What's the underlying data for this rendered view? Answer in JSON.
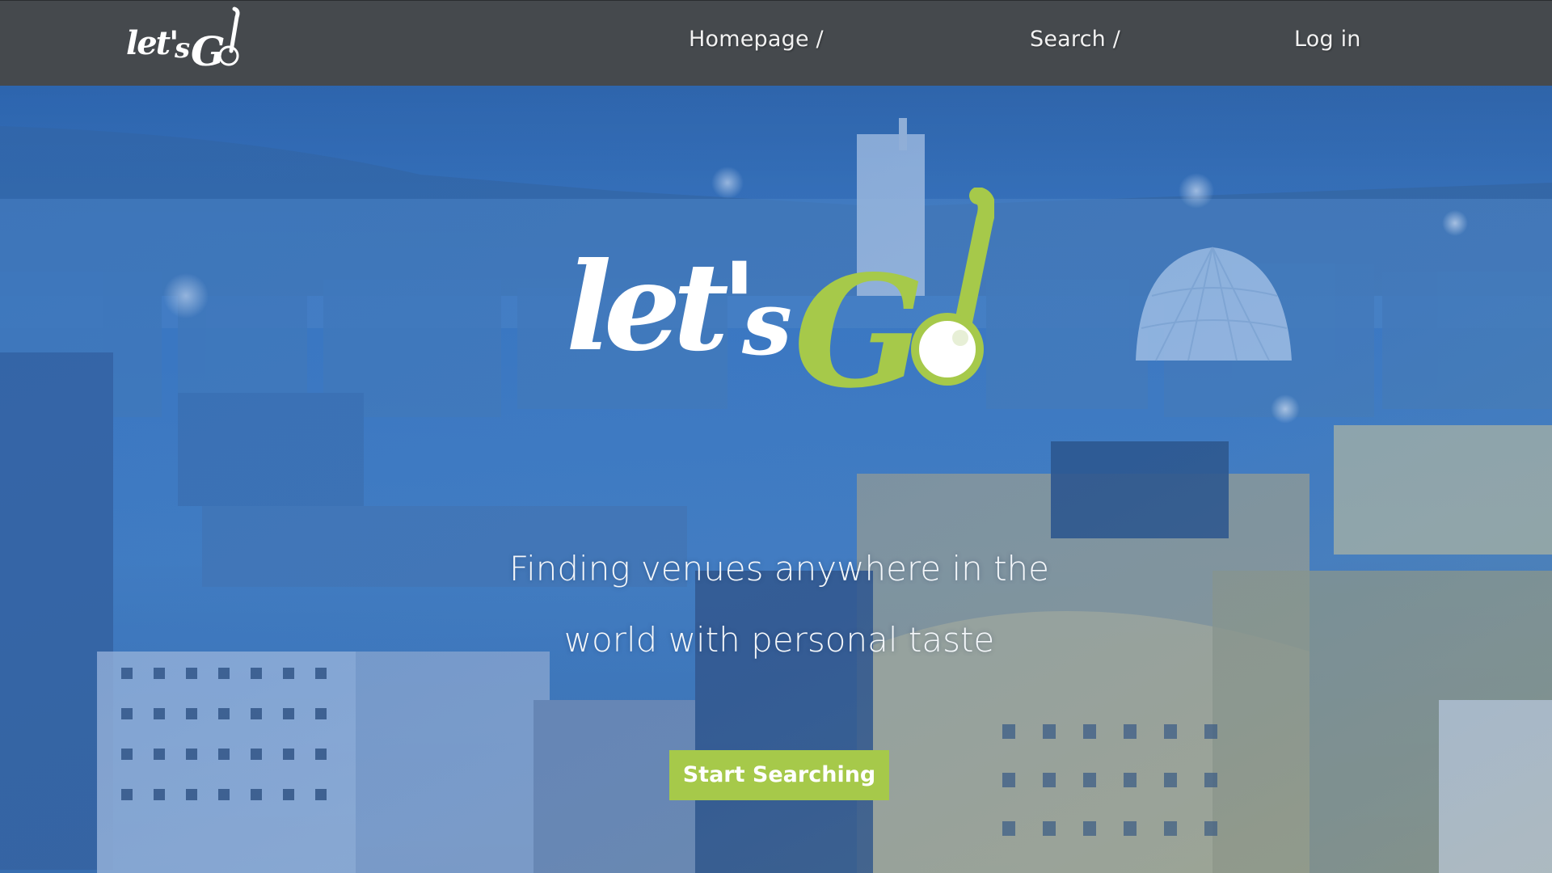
{
  "nav": {
    "logo_text": "let'sGo!",
    "links": [
      {
        "label": "Homepage /"
      },
      {
        "label": "Search /"
      },
      {
        "label": "Log in"
      }
    ]
  },
  "hero": {
    "logo_text": "let'sGo!",
    "tagline_line1": "Finding venues anywhere in the",
    "tagline_line2": "world with personal taste",
    "cta_label": "Start Searching",
    "background": "aerial city skyline photo with blue tint"
  },
  "colors": {
    "navbar_bg": "#45494d",
    "accent_green": "#a6c94a",
    "hero_tint": "#3a78c2",
    "text_light": "#f4f7fa"
  }
}
